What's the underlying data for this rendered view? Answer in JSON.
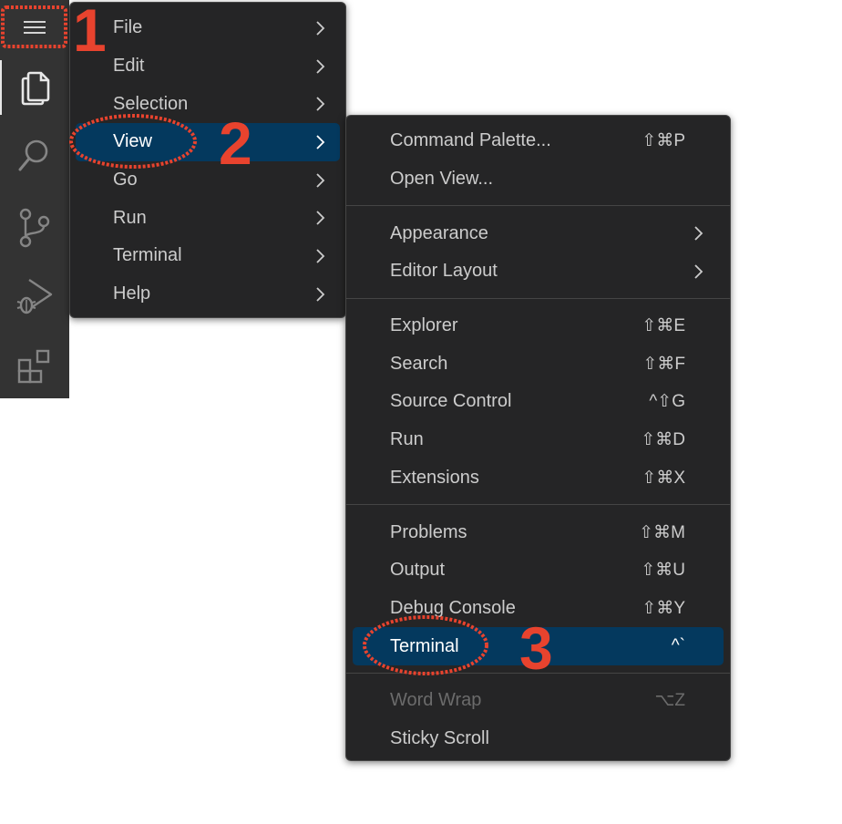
{
  "activity_bar": {
    "icons": [
      "menu-icon",
      "files-icon",
      "search-icon",
      "source-control-icon",
      "run-debug-icon",
      "extensions-icon"
    ]
  },
  "main_menu": {
    "items": [
      {
        "label": "File"
      },
      {
        "label": "Edit"
      },
      {
        "label": "Selection"
      },
      {
        "label": "View",
        "highlighted": true
      },
      {
        "label": "Go"
      },
      {
        "label": "Run"
      },
      {
        "label": "Terminal"
      },
      {
        "label": "Help"
      }
    ]
  },
  "view_menu": {
    "groups": [
      [
        {
          "label": "Command Palette...",
          "shortcut": "⇧⌘P"
        },
        {
          "label": "Open View..."
        }
      ],
      [
        {
          "label": "Appearance",
          "submenu": true
        },
        {
          "label": "Editor Layout",
          "submenu": true
        }
      ],
      [
        {
          "label": "Explorer",
          "shortcut": "⇧⌘E"
        },
        {
          "label": "Search",
          "shortcut": "⇧⌘F"
        },
        {
          "label": "Source Control",
          "shortcut": "^⇧G"
        },
        {
          "label": "Run",
          "shortcut": "⇧⌘D"
        },
        {
          "label": "Extensions",
          "shortcut": "⇧⌘X"
        }
      ],
      [
        {
          "label": "Problems",
          "shortcut": "⇧⌘M"
        },
        {
          "label": "Output",
          "shortcut": "⇧⌘U"
        },
        {
          "label": "Debug Console",
          "shortcut": "⇧⌘Y"
        },
        {
          "label": "Terminal",
          "shortcut": "^`",
          "highlighted": true
        }
      ],
      [
        {
          "label": "Word Wrap",
          "shortcut": "⌥Z",
          "disabled": true
        },
        {
          "label": "Sticky Scroll"
        }
      ]
    ]
  },
  "annotations": {
    "step1": "1",
    "step2": "2",
    "step3": "3",
    "color": "#e8432e"
  },
  "colors": {
    "menu_bg": "#252526",
    "highlight_bg": "#04395e",
    "activity_bg": "#333333",
    "text": "#cccccc"
  }
}
